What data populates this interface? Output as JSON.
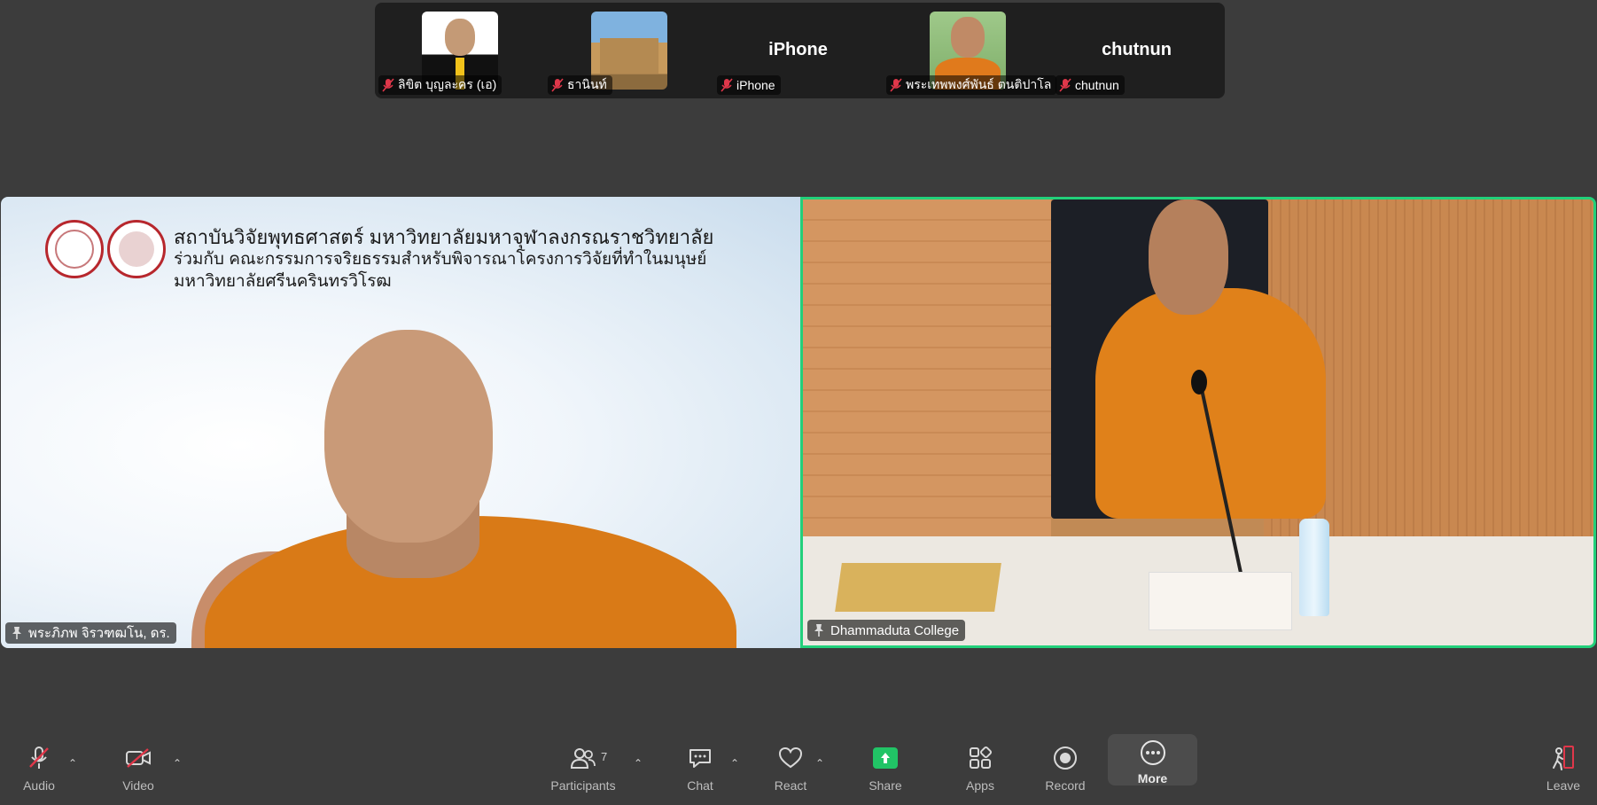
{
  "top_strip": {
    "tiles": [
      {
        "name": "ลิขิต บุญละคร (เอ)",
        "display": ""
      },
      {
        "name": "ธานินท์",
        "display": ""
      },
      {
        "name": "iPhone",
        "display": "iPhone"
      },
      {
        "name": "พระเทพพงศ์พันธ์ ตนติปาโล",
        "display": ""
      },
      {
        "name": "chutnun",
        "display": "chutnun"
      }
    ]
  },
  "main": {
    "left": {
      "name": "พระภิภพ จิรวฑฒโน, ดร.",
      "slide": {
        "line1": "สถาบันวิจัยพุทธศาสตร์ มหาวิทยาลัยมหาจุฬาลงกรณราชวิทยาลัย",
        "line2": "ร่วมกับ คณะกรรมการจริยธรรมสำหรับพิจารณาโครงการวิจัยที่ทำในมนุษย์",
        "line3": "มหาวิทยาลัยศรีนครินทรวิโรฒ"
      }
    },
    "right": {
      "name": "Dhammaduta College"
    }
  },
  "toolbar": {
    "audio": "Audio",
    "video": "Video",
    "participants": "Participants",
    "participants_count": "7",
    "chat": "Chat",
    "react": "React",
    "share": "Share",
    "apps": "Apps",
    "record": "Record",
    "more": "More",
    "leave": "Leave"
  },
  "colors": {
    "background": "#3c3c3c",
    "active_speaker_border": "#22d07a",
    "share_green": "#21c466",
    "mute_red": "#e0374a"
  }
}
